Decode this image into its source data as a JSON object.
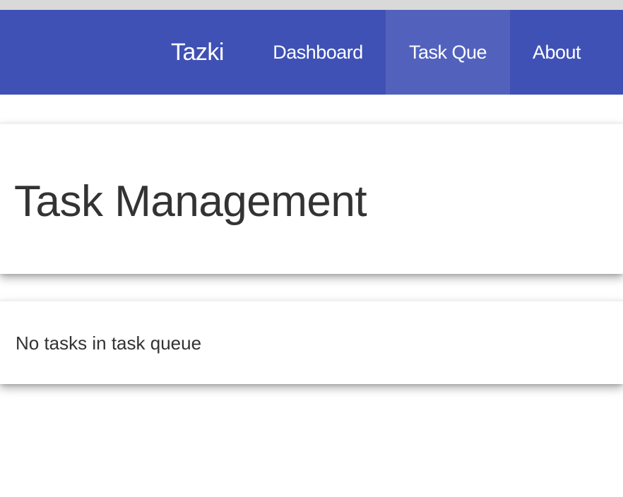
{
  "navbar": {
    "brand": "Tazki",
    "items": [
      {
        "label": "Dashboard",
        "active": false
      },
      {
        "label": "Task Que",
        "active": true
      },
      {
        "label": "About",
        "active": false
      }
    ]
  },
  "main": {
    "title": "Task Management",
    "empty_message": "No tasks in task queue"
  },
  "colors": {
    "navbar": "#3f51b5",
    "navbar_active": "#5262bc",
    "text": "#333333"
  }
}
